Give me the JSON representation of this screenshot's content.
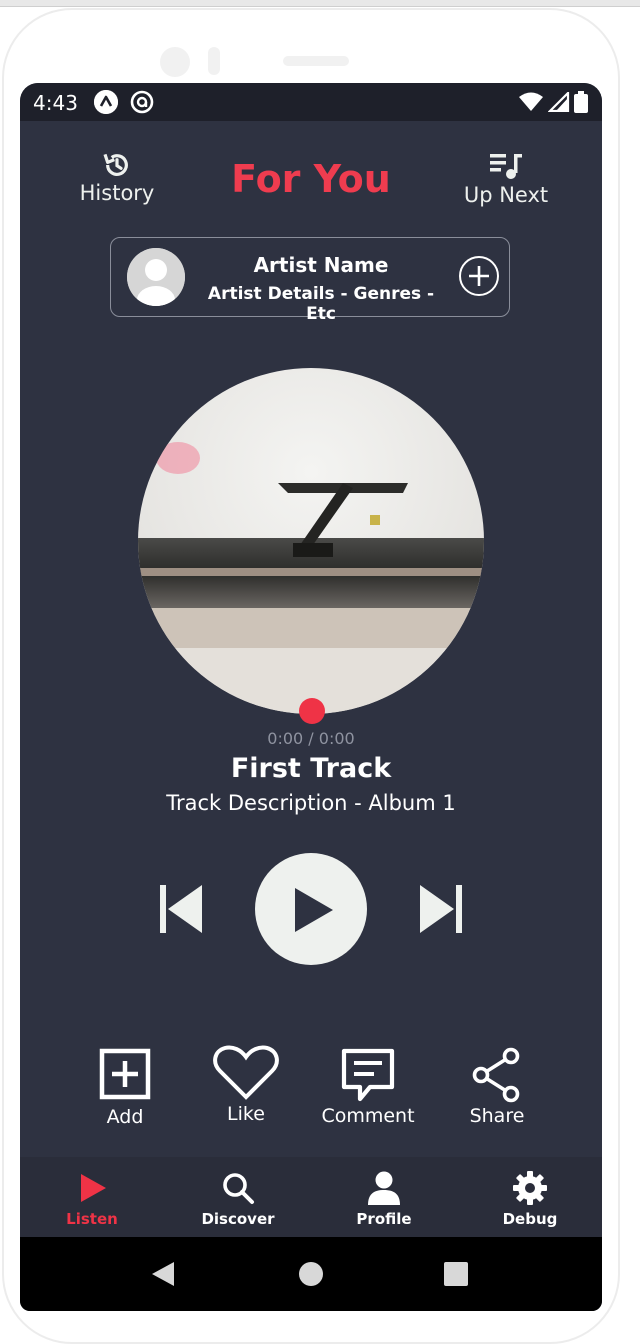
{
  "status_bar": {
    "time": "4:43",
    "notif_icons": [
      "android-app-icon",
      "at-sign-icon"
    ],
    "right_icons": [
      "wifi-icon",
      "signal-icon",
      "battery-icon"
    ]
  },
  "header": {
    "history_label": "History",
    "title": "For You",
    "up_next_label": "Up Next"
  },
  "artist": {
    "name": "Artist Name",
    "details": "Artist Details - Genres - Etc"
  },
  "player": {
    "time": "0:00 / 0:00",
    "track_title": "First Track",
    "track_description": "Track Description - Album 1",
    "progress": 0
  },
  "actions": [
    {
      "label": "Add",
      "icon": "add-box-icon"
    },
    {
      "label": "Like",
      "icon": "heart-icon"
    },
    {
      "label": "Comment",
      "icon": "comment-icon"
    },
    {
      "label": "Share",
      "icon": "share-icon"
    }
  ],
  "bottom_nav": [
    {
      "label": "Listen",
      "icon": "play-icon",
      "active": true
    },
    {
      "label": "Discover",
      "icon": "search-icon",
      "active": false
    },
    {
      "label": "Profile",
      "icon": "person-icon",
      "active": false
    },
    {
      "label": "Debug",
      "icon": "gear-icon",
      "active": false
    }
  ],
  "colors": {
    "accent": "#ef3c4f",
    "background": "#2e3241",
    "nav_background": "#2a2d3a",
    "status_bar": "#1e202a",
    "control_fill": "#eef1ee"
  }
}
